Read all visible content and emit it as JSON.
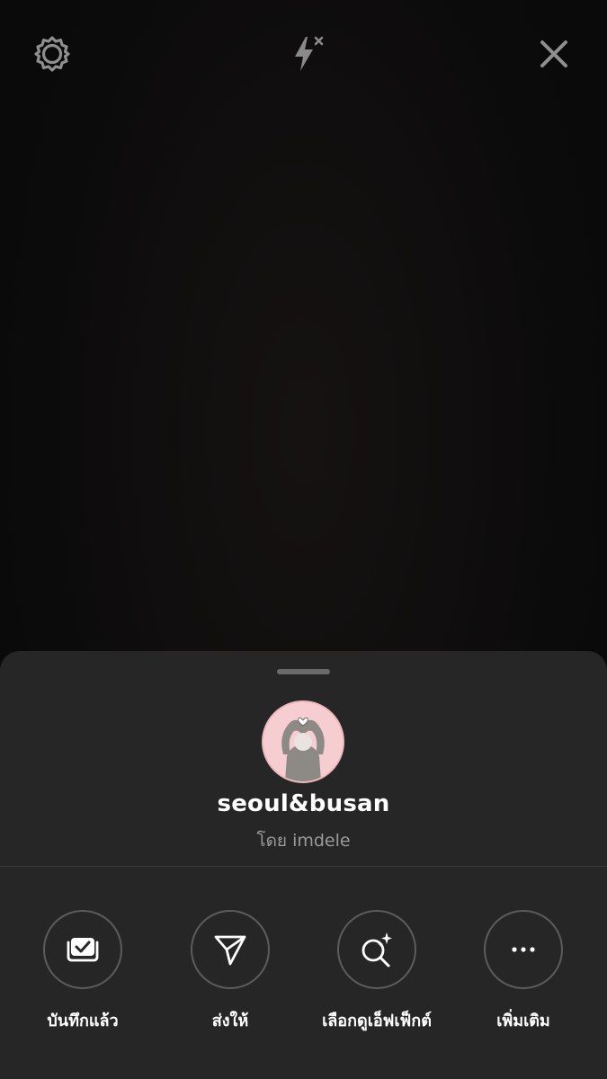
{
  "camera": {
    "settings_icon": "gear-icon",
    "flash_icon": "flash-off-icon",
    "close_icon": "close-icon"
  },
  "effect": {
    "name": "seoul&busan",
    "by_label": "โดย",
    "author": "imdele"
  },
  "actions": [
    {
      "label": "บันทึกแล้ว",
      "icon": "saved-check-icon"
    },
    {
      "label": "ส่งให้",
      "icon": "send-icon"
    },
    {
      "label": "เลือกดูเอ็ฟเฟ็กต์",
      "icon": "browse-effects-icon"
    },
    {
      "label": "เพิ่มเติม",
      "icon": "more-icon"
    }
  ],
  "colors": {
    "sheet": "#262626",
    "avatar_bg": "#f5c9cd",
    "text_primary": "#ffffff",
    "text_secondary": "#9a9a9a"
  }
}
